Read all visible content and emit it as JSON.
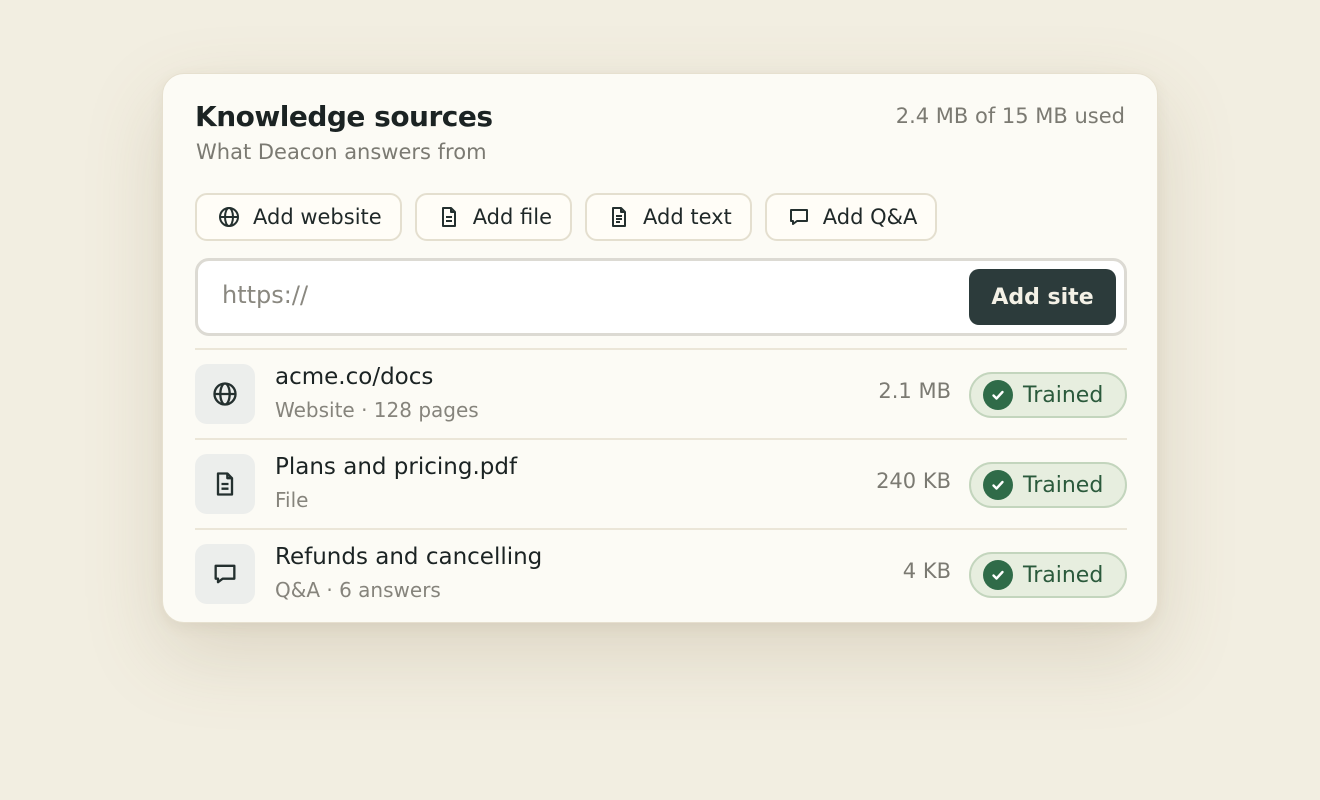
{
  "header": {
    "title": "Knowledge sources",
    "subtitle": "What Deacon answers from",
    "usage": "2.4 MB of 15 MB used"
  },
  "actions": [
    {
      "label": "Add website",
      "icon": "globe-icon"
    },
    {
      "label": "Add file",
      "icon": "file-icon"
    },
    {
      "label": "Add text",
      "icon": "text-file-icon"
    },
    {
      "label": "Add Q&A",
      "icon": "chat-bubble-icon"
    }
  ],
  "url_form": {
    "placeholder": "https://",
    "value": "",
    "submit_label": "Add site"
  },
  "sources": [
    {
      "name": "acme.co/docs",
      "meta": "Website · 128 pages",
      "size": "2.1 MB",
      "status": "Trained",
      "icon": "globe-icon"
    },
    {
      "name": "Plans and pricing.pdf",
      "meta": "File",
      "size": "240 KB",
      "status": "Trained",
      "icon": "file-icon"
    },
    {
      "name": "Refunds and cancelling",
      "meta": "Q&A · 6 answers",
      "size": "4 KB",
      "status": "Trained",
      "icon": "chat-bubble-icon"
    }
  ],
  "colors": {
    "background": "#f2eee1",
    "card": "#fcfbf5",
    "primary_button": "#2c3b3b",
    "trained_badge": "#e7eedf",
    "trained_check": "#2f6b48"
  }
}
